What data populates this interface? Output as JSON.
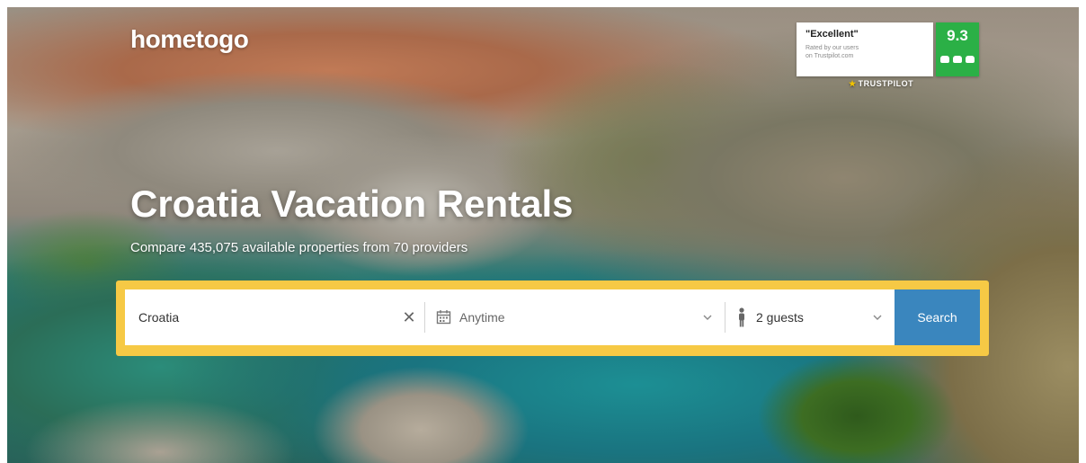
{
  "brand": {
    "logo_text": "hometogo"
  },
  "trustpilot": {
    "quote": "\"Excellent\"",
    "sub_line_1": "Rated by our users",
    "sub_line_2": "on Trustpilot.com",
    "score": "9.3",
    "brand_label": "TRUSTPILOT"
  },
  "hero": {
    "title": "Croatia Vacation Rentals",
    "subtitle": "Compare 435,075 available properties from 70 providers"
  },
  "search": {
    "destination_value": "Croatia",
    "date_label": "Anytime",
    "guests_label": "2 guests",
    "button_label": "Search"
  },
  "icons": {
    "clear": "close-icon",
    "date": "calendar-icon",
    "guests": "person-icon",
    "dropdown": "chevron-down-icon",
    "rating": "thumbs-up-icon",
    "trust_brand": "star-icon"
  },
  "colors": {
    "search_border": "#f6c945",
    "search_button": "#3a86be",
    "trust_score_bg": "#2bb046"
  }
}
